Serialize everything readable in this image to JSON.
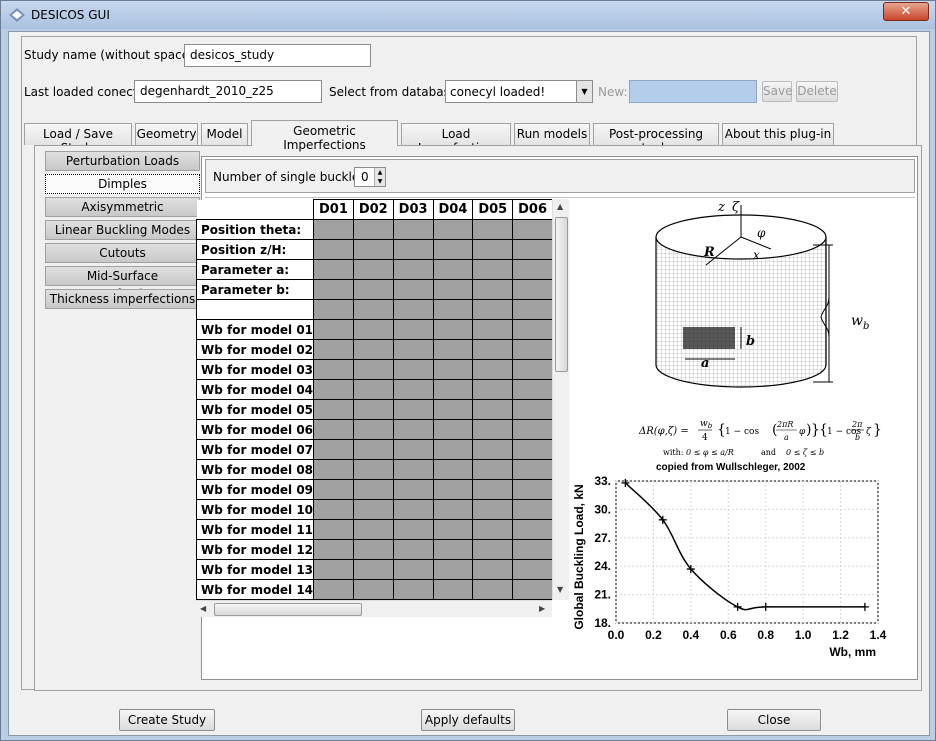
{
  "window": {
    "title": "DESICOS GUI",
    "close_glyph": "✕"
  },
  "form": {
    "study_name_label": "Study name (without spaces):",
    "study_name_value": "desicos_study",
    "last_loaded_label": "Last loaded conecyl:",
    "last_loaded_value": "degenhardt_2010_z25",
    "select_db_label": "Select from database:",
    "select_db_value": "conecyl loaded!",
    "new_label": "New:",
    "new_value": "",
    "save_label": "Save",
    "delete_label": "Delete"
  },
  "tabs": [
    {
      "label": "Load / Save Study"
    },
    {
      "label": "Geometry"
    },
    {
      "label": "Model"
    },
    {
      "label": "Geometric Imperfections"
    },
    {
      "label": "Load Imperfection"
    },
    {
      "label": "Run models"
    },
    {
      "label": "Post-processing tools"
    },
    {
      "label": "About this plug-in"
    }
  ],
  "subtabs": [
    {
      "label": "Perturbation Loads"
    },
    {
      "label": "Dimples"
    },
    {
      "label": "Axisymmetric"
    },
    {
      "label": "Linear Buckling Modes"
    },
    {
      "label": "Cutouts"
    },
    {
      "label": "Mid-Surface Imperfections"
    },
    {
      "label": "Thickness imperfections"
    }
  ],
  "dimples": {
    "num_buckles_label": "Number of single buckles",
    "num_buckles_value": "0",
    "columns": [
      "D01",
      "D02",
      "D03",
      "D04",
      "D05",
      "D06"
    ],
    "rows": [
      "Position theta:",
      "Position z/H:",
      "Parameter a:",
      "Parameter b:",
      "",
      "Wb for model 01",
      "Wb for model 02",
      "Wb for model 03",
      "Wb for model 04",
      "Wb for model 05",
      "Wb for model 06",
      "Wb for model 07",
      "Wb for model 08",
      "Wb for model 09",
      "Wb for model 10",
      "Wb for model 11",
      "Wb for model 12",
      "Wb for model 13",
      "Wb for model 14"
    ]
  },
  "figure": {
    "axis_z": "z",
    "axis_zeta": "ζ",
    "label_R": "R",
    "label_phi": "φ",
    "label_x": "x",
    "label_a": "a",
    "label_b": "b",
    "label_wb": "w",
    "label_wb_sub": "b",
    "formula_lhs": "ΔR(φ,ζ) =",
    "formula_wb": "w",
    "formula_wb_sub": "b",
    "formula_4": "4",
    "formula_f1_pre": "1 − cos",
    "formula_f1_num": "2πR",
    "formula_f1_den": "a",
    "formula_f1_var": "φ",
    "formula_f2_pre": "1 − cos",
    "formula_f2_num": "2π",
    "formula_f2_den": "b",
    "formula_f2_var": "ζ",
    "formula_with": "with:",
    "formula_cond1": "0 ≤  φ  ≤ a/R",
    "formula_and": "and",
    "formula_cond2": "0 ≤  ζ  ≤ b",
    "caption": "copied from Wullschleger, 2002"
  },
  "chart_data": {
    "type": "line",
    "x": [
      0.05,
      0.25,
      0.4,
      0.65,
      0.8,
      1.33
    ],
    "y": [
      32.8,
      28.9,
      23.7,
      19.7,
      19.7,
      19.7
    ],
    "xlabel": "Wb, mm",
    "ylabel": "Global Buckling Load, kN",
    "xlim": [
      0.0,
      1.4
    ],
    "ylim": [
      18.0,
      33.0
    ],
    "xticks": [
      "0.0",
      "0.2",
      "0.4",
      "0.6",
      "0.8",
      "1.0",
      "1.2",
      "1.4"
    ],
    "yticks": [
      "18.",
      "21.",
      "24.",
      "27.",
      "30.",
      "33."
    ],
    "grid": true
  },
  "footer": {
    "create_label": "Create Study",
    "defaults_label": "Apply defaults",
    "close_label": "Close"
  },
  "colors": {
    "titlebar": "#b9cde5",
    "cell_fill": "#a0a0a0",
    "new_field": "#b4cdea"
  }
}
